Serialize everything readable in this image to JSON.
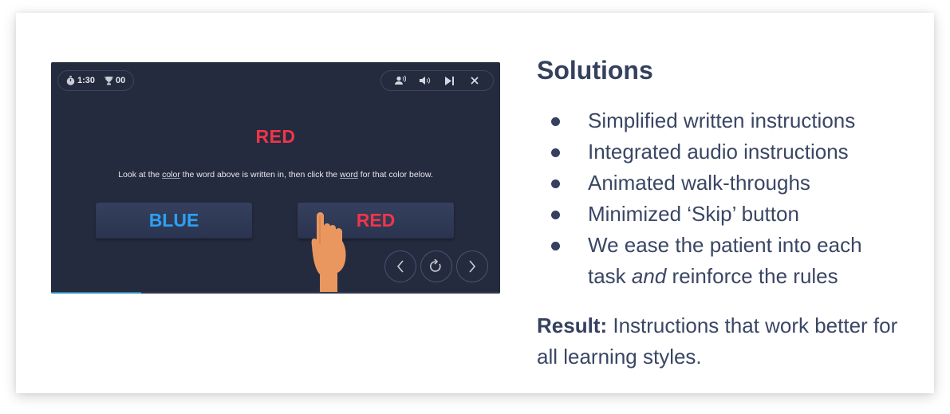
{
  "game": {
    "timer": "1:30",
    "score": "00",
    "target_word": "RED",
    "target_color": "#f0354a",
    "instruction": {
      "part1": "Look at the ",
      "underline1": "color",
      "part2": " the word above is written in, then click the ",
      "underline2": "word",
      "part3": " for that color below."
    },
    "answers": [
      {
        "label": "BLUE",
        "color": "#2da0f0"
      },
      {
        "label": "RED",
        "color": "#f0354a"
      }
    ],
    "controls": [
      "audio-instructions-icon",
      "volume-icon",
      "skip-icon",
      "close-icon"
    ],
    "nav": [
      "previous-icon",
      "replay-icon",
      "next-icon"
    ],
    "progress_percent": 20
  },
  "panel": {
    "heading": "Solutions",
    "bullets": [
      {
        "text": "Simplified written instructions"
      },
      {
        "text": "Integrated audio instructions"
      },
      {
        "text": "Animated walk-throughs"
      },
      {
        "text": "Minimized ‘Skip’ button"
      },
      {
        "pre": "We ease the patient into each task ",
        "em": "and",
        "post": " reinforce the rules"
      }
    ],
    "result_label": "Result:",
    "result_text": " Instructions that work better for all learning styles."
  }
}
